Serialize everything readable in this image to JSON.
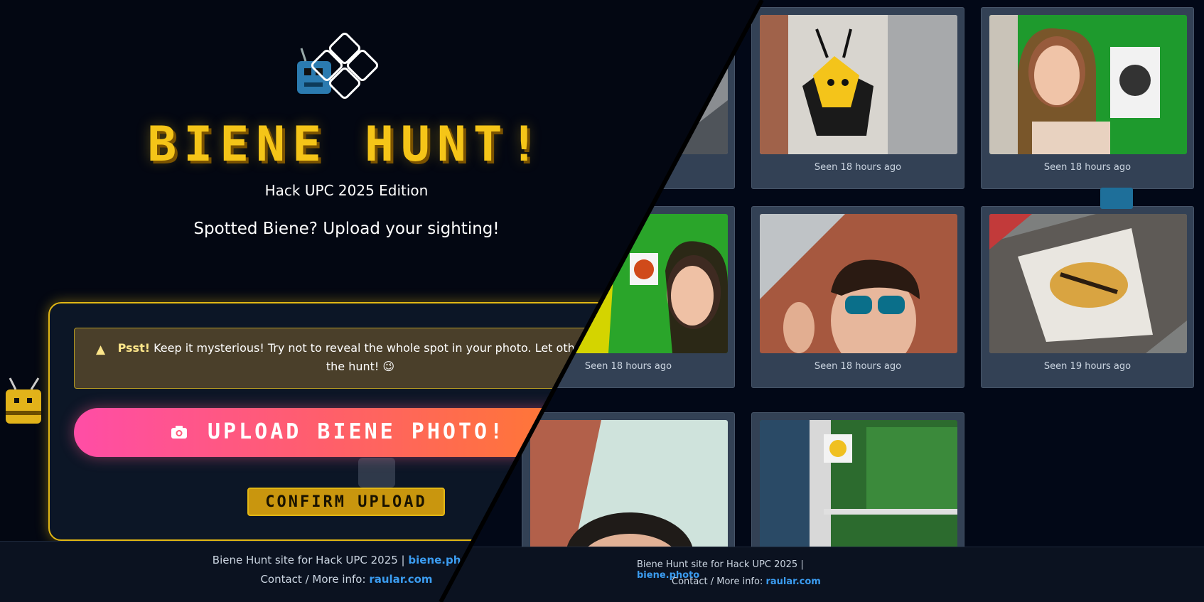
{
  "gallery": {
    "cards": [
      {
        "seen": ""
      },
      {
        "seen": "Seen 18 hours ago"
      },
      {
        "seen": "Seen 18 hours ago"
      },
      {
        "seen": "Seen 18 hours ago"
      },
      {
        "seen": "Seen 18 hours ago"
      },
      {
        "seen": "Seen 19 hours ago"
      },
      {
        "seen": ""
      },
      {
        "seen": ""
      }
    ],
    "footer": {
      "line1_prefix": "Biene Hunt site for Hack UPC 2025 |",
      "line1_link": "biene.photo",
      "line2_prefix": "Contact / More info:",
      "line2_link": "raular.com"
    }
  },
  "landing": {
    "title": "BIENE HUNT!",
    "edition": "Hack UPC 2025 Edition",
    "tagline": "Spotted Biene? Upload your sighting!",
    "notice": {
      "icon": "warning-icon",
      "highlight": "Psst!",
      "text": "Keep it mysterious! Try not to reveal the whole spot in your photo. Let others e",
      "text2": "the hunt! 😉"
    },
    "upload_label": "UPLOAD BIENE PHOTO!",
    "upload_icon": "camera-icon",
    "confirm_label": "CONFIRM UPLOAD",
    "footer": {
      "line1_prefix": "Biene Hunt site for Hack UPC 2025 |",
      "line1_link": "biene.photo",
      "line2_prefix": "Contact / More info:",
      "line2_link": "raular.com"
    }
  },
  "colors": {
    "accent": "#f5c518",
    "upload_gradient_start": "#ff4da6",
    "upload_gradient_end": "#ff7a2e",
    "link": "#3b9cf0"
  }
}
